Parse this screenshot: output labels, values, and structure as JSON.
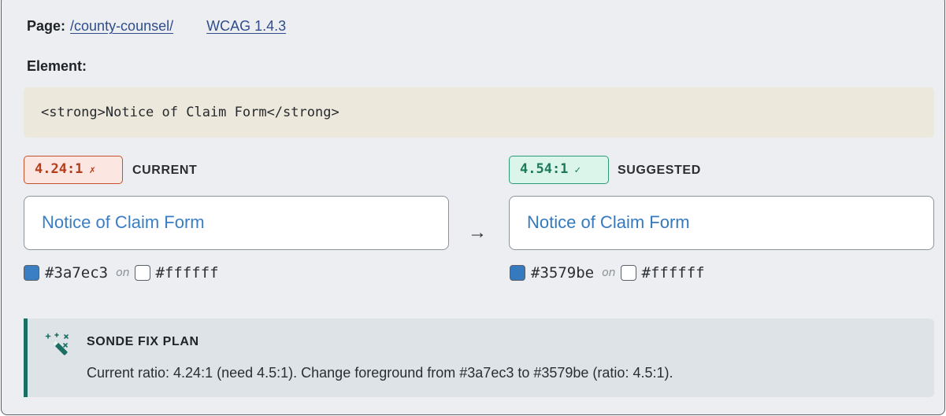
{
  "page": {
    "label": "Page:",
    "path_link": "/county-counsel/",
    "wcag_link": "WCAG 1.4.3"
  },
  "element": {
    "label": "Element:",
    "code": "<strong>Notice of Claim Form</strong>"
  },
  "current": {
    "ratio": "4.24:1",
    "status_mark": "✗",
    "title": "CURRENT",
    "preview_text": "Notice of Claim Form",
    "fg_hex": "#3a7ec3",
    "on_label": "on",
    "bg_hex": "#ffffff",
    "fg_color": "#3a7ec3",
    "bg_color": "#ffffff"
  },
  "arrow": "→",
  "suggested": {
    "ratio": "4.54:1",
    "status_mark": "✓",
    "title": "SUGGESTED",
    "preview_text": "Notice of Claim Form",
    "fg_hex": "#3579be",
    "on_label": "on",
    "bg_hex": "#ffffff",
    "fg_color": "#3579be",
    "bg_color": "#ffffff"
  },
  "fix_plan": {
    "icon": "magic-wand-icon",
    "title": "SONDE FIX PLAN",
    "text": "Current ratio: 4.24:1 (need 4.5:1). Change foreground from #3a7ec3 to #3579be (ratio: 4.5:1)."
  }
}
